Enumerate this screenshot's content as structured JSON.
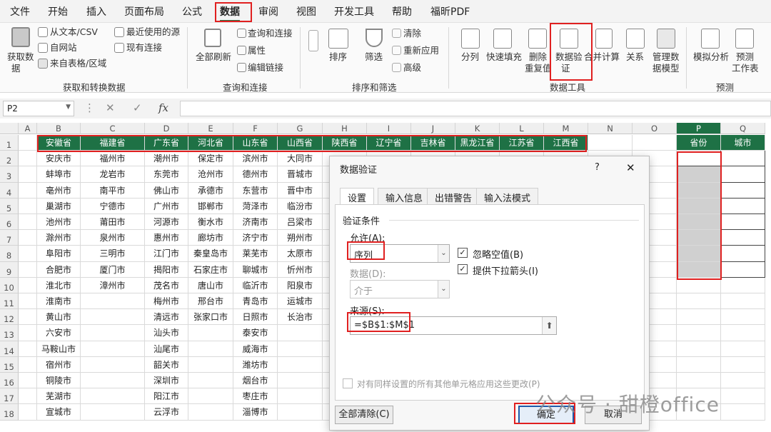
{
  "menu": {
    "tabs": [
      "文件",
      "开始",
      "插入",
      "页面布局",
      "公式",
      "数据",
      "审阅",
      "视图",
      "开发工具",
      "帮助",
      "福昕PDF"
    ],
    "active": "数据"
  },
  "ribbon": {
    "get_data": [
      "获取数",
      "据"
    ],
    "from_text": "从文本/CSV",
    "from_web": "自网站",
    "from_table": "来自表格/区域",
    "recent_sources": "最近使用的源",
    "existing_conn": "现有连接",
    "refresh_all": "全部刷新",
    "queries_conn": "查询和连接",
    "properties": "属性",
    "edit_links": "编辑链接",
    "sort": "排序",
    "filter": "筛选",
    "clear": "清除",
    "reapply": "重新应用",
    "advanced": "高级",
    "split": "分列",
    "flash_fill": "快速填充",
    "remove_dup": [
      "删除",
      "重复值"
    ],
    "data_validation": [
      "数据验",
      "证"
    ],
    "consolidate": "合并计算",
    "relations": "关系",
    "manage_model": [
      "管理数",
      "据模型"
    ],
    "what_if": "模拟分析",
    "forecast_sheet": [
      "预测",
      "工作表"
    ],
    "groups": [
      "获取和转换数据",
      "查询和连接",
      "排序和筛选",
      "数据工具",
      "预测"
    ]
  },
  "formula": {
    "namebox": "P2",
    "fx": "fx",
    "value": ""
  },
  "columns": [
    "A",
    "B",
    "C",
    "D",
    "E",
    "F",
    "G",
    "H",
    "I",
    "J",
    "K",
    "L",
    "M",
    "N",
    "O",
    "P",
    "Q"
  ],
  "rows": [
    "1",
    "2",
    "3",
    "4",
    "5",
    "6",
    "7",
    "8",
    "9",
    "10",
    "11",
    "12",
    "13",
    "14",
    "15",
    "16",
    "17",
    "18"
  ],
  "provinces": [
    "安徽省",
    "福建省",
    "广东省",
    "河北省",
    "山东省",
    "山西省",
    "陕西省",
    "辽宁省",
    "吉林省",
    "黑龙江省",
    "江苏省",
    "江西省"
  ],
  "cities": {
    "B": [
      "安庆市",
      "蚌埠市",
      "亳州市",
      "巢湖市",
      "池州市",
      "滁州市",
      "阜阳市",
      "合肥市",
      "淮北市",
      "淮南市",
      "黄山市",
      "六安市",
      "马鞍山市",
      "宿州市",
      "铜陵市",
      "芜湖市",
      "宣城市"
    ],
    "C": [
      "福州市",
      "龙岩市",
      "南平市",
      "宁德市",
      "莆田市",
      "泉州市",
      "三明市",
      "厦门市",
      "漳州市"
    ],
    "D": [
      "潮州市",
      "东莞市",
      "佛山市",
      "广州市",
      "河源市",
      "惠州市",
      "江门市",
      "揭阳市",
      "茂名市",
      "梅州市",
      "清远市",
      "汕头市",
      "汕尾市",
      "韶关市",
      "深圳市",
      "阳江市",
      "云浮市"
    ],
    "E": [
      "保定市",
      "沧州市",
      "承德市",
      "邯郸市",
      "衡水市",
      "廊坊市",
      "秦皇岛市",
      "石家庄市",
      "唐山市",
      "邢台市",
      "张家口市"
    ],
    "F": [
      "滨州市",
      "德州市",
      "东营市",
      "菏泽市",
      "济南市",
      "济宁市",
      "莱芜市",
      "聊城市",
      "临沂市",
      "青岛市",
      "日照市",
      "泰安市",
      "威海市",
      "潍坊市",
      "烟台市",
      "枣庄市",
      "淄博市"
    ],
    "G": [
      "大同市",
      "晋城市",
      "晋中市",
      "临汾市",
      "吕梁市",
      "朔州市",
      "太原市",
      "忻州市",
      "阳泉市",
      "运城市",
      "长治市"
    ]
  },
  "side_headers": {
    "P": "省份",
    "Q": "城市"
  },
  "dialog": {
    "title": "数据验证",
    "help": "?",
    "close": "✕",
    "tabs": [
      "设置",
      "输入信息",
      "出错警告",
      "输入法模式"
    ],
    "criteria_label": "验证条件",
    "allow_label": "允许(A):",
    "allow_value": "序列",
    "data_label": "数据(D):",
    "data_value": "介于",
    "ignore_blank": "忽略空值(B)",
    "dropdown": "提供下拉箭头(I)",
    "source_label": "来源(S):",
    "source_value": "=$B$1:$M$1",
    "apply_all": "对有同样设置的所有其他单元格应用这些更改(P)",
    "clear_all": "全部清除(C)",
    "ok": "确定",
    "cancel": "取消"
  },
  "watermark": "公众号 · 甜橙office"
}
